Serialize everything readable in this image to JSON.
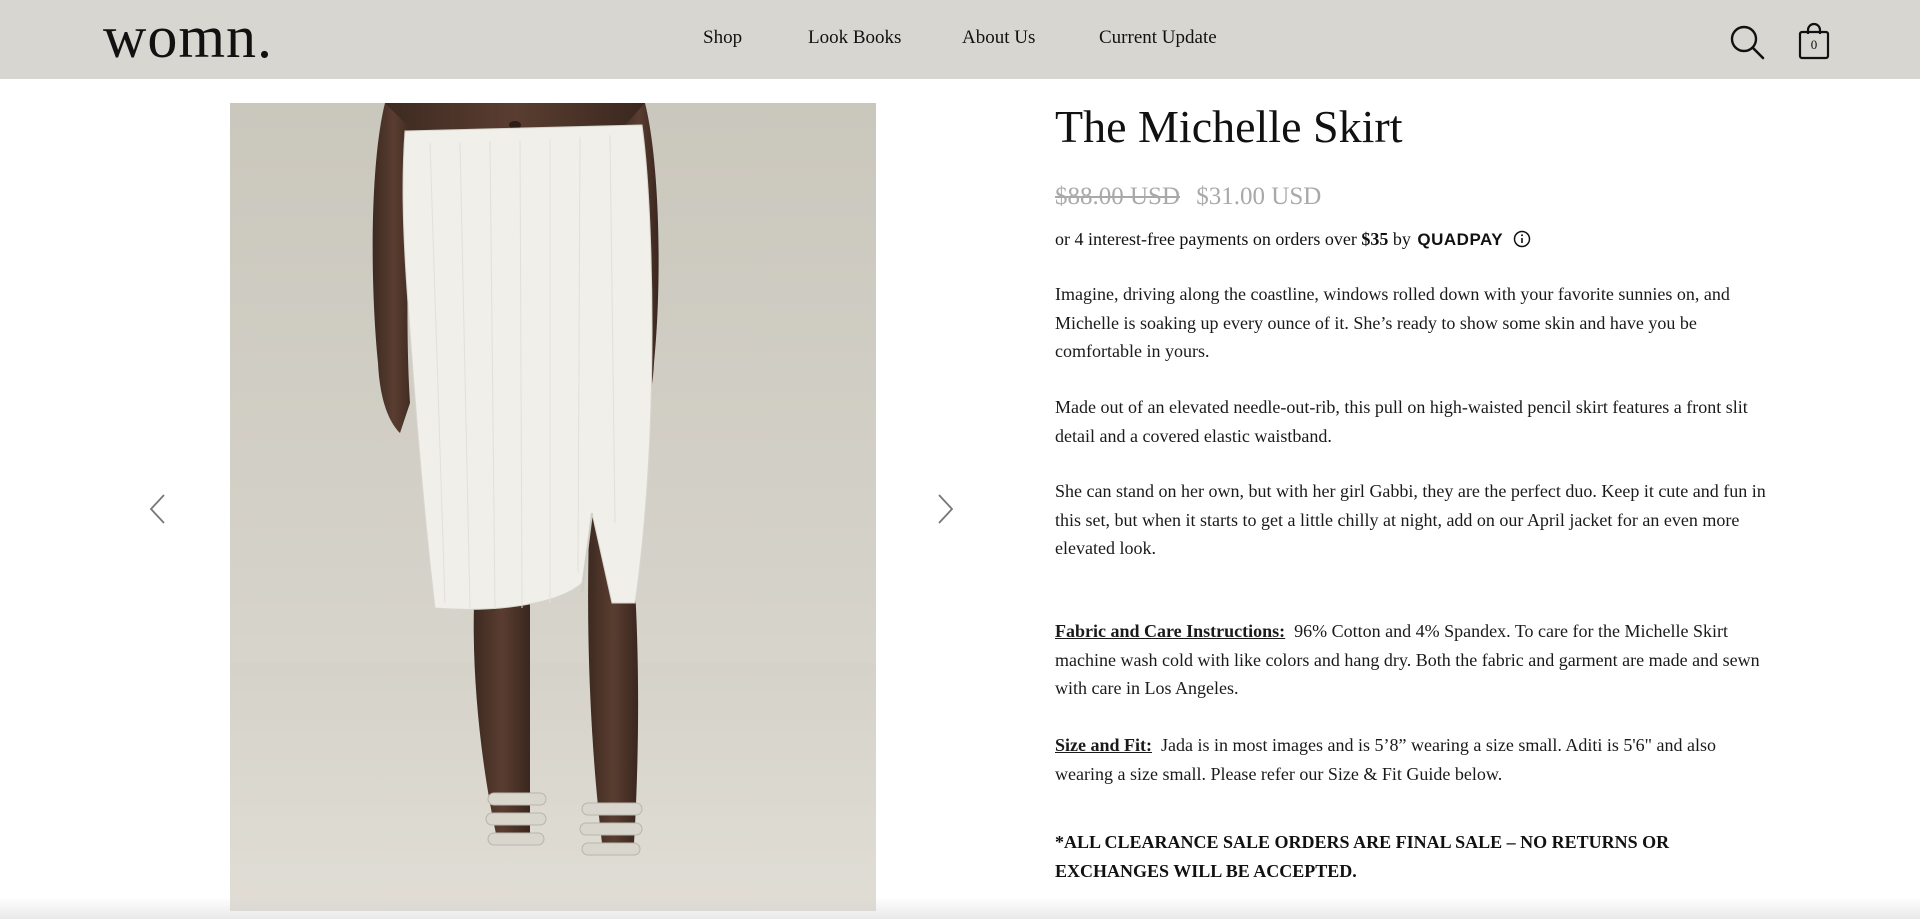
{
  "header": {
    "logo": "womn.",
    "nav": [
      {
        "label": "Shop"
      },
      {
        "label": "Look Books"
      },
      {
        "label": "About Us"
      },
      {
        "label": "Current Update"
      }
    ],
    "cart_count": "0",
    "icons": {
      "search": "search-icon",
      "cart": "shopping-bag-icon"
    }
  },
  "gallery": {
    "prev_icon": "chevron-left-icon",
    "next_icon": "chevron-right-icon",
    "image_alt": "Model wearing a white ribbed midi pencil skirt with front slit and strappy sandals"
  },
  "product": {
    "title": "The Michelle Skirt",
    "price_original": "$88.00 USD",
    "price_sale": "$31.00 USD",
    "installments": {
      "text": "or 4 interest-free payments on orders over",
      "amount": "$35",
      "by": "by",
      "provider": "QUADPAY"
    },
    "description": [
      "Imagine, driving along the coastline, windows rolled down with your favorite sunnies on, and Michelle is soaking up every ounce of it. She’s ready to show some skin and have you be comfortable in yours.",
      "Made out of an elevated needle-out-rib, this pull on high-waisted pencil skirt features a front slit detail and a covered elastic waistband.",
      "She can stand on her own, but with her girl Gabbi, they are the perfect duo. Keep it cute and fun in this set, but when it starts to get a little chilly at night, add on our April jacket for an even more elevated look."
    ],
    "fabric": {
      "label": "Fabric and Care Instructions:",
      "text": "96% Cotton and 4% Spandex. To care for the Michelle Skirt machine wash cold with like colors and hang dry. Both the fabric and garment are made and sewn with care in Los Angeles."
    },
    "size": {
      "label": "Size and Fit:",
      "text": "Jada is in most images and is 5’8” wearing a size small. Aditi is 5'6\" and also wearing a size small. Please refer our Size & Fit Guide below."
    },
    "notice": "*ALL CLEARANCE SALE ORDERS ARE FINAL SALE – NO RETURNS OR EXCHANGES WILL BE ACCEPTED."
  },
  "colors": {
    "header_bg": "#d8d6d0",
    "text": "#1a1a1a",
    "price_muted": "#a9a9a9",
    "skirt": "#f0efea"
  }
}
